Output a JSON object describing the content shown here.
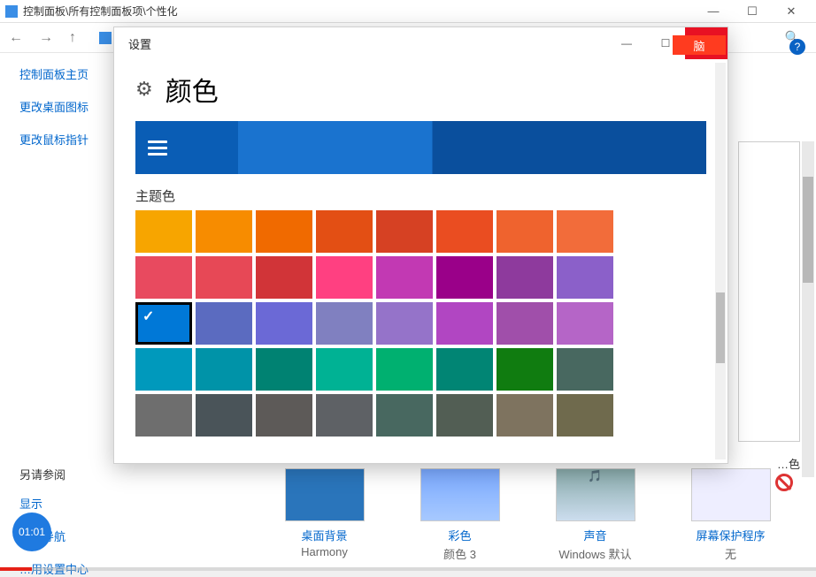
{
  "outer": {
    "title": "控制面板\\所有控制面板项\\个性化",
    "breadcrumb": [
      "控制面板",
      "所有控制面板项",
      "个性化"
    ]
  },
  "leftnav": {
    "home": "控制面板主页",
    "change_icons": "更改桌面图标",
    "change_pointer": "更改鼠标指针",
    "see_also": "另请参阅",
    "display": "显示",
    "nav_taskbar": "…和导航",
    "ease_center": "…用设置中心"
  },
  "tiles": {
    "t1": {
      "title": "桌面背景",
      "sub": "Harmony"
    },
    "t2": {
      "title": "彩色",
      "sub": "颜色 3"
    },
    "t3": {
      "title": "声音",
      "sub": "Windows 默认"
    },
    "t4": {
      "title": "屏幕保护程序",
      "sub": "无"
    }
  },
  "right_hint_label": "…色",
  "help": "?",
  "desk_clip": "脑",
  "settings": {
    "title": "设置",
    "heading": "颜色",
    "section": "主题色",
    "selected_index": 16,
    "colors": [
      "#f7a500",
      "#f78c00",
      "#f06a00",
      "#e34f14",
      "#d64123",
      "#ea4d21",
      "#ef632e",
      "#f26c3a",
      "#e84a5f",
      "#e74856",
      "#d13438",
      "#ff4081",
      "#c239b3",
      "#9a0089",
      "#8e3a9d",
      "#8b60c9",
      "#0078d7",
      "#5b6bc0",
      "#6b69d6",
      "#8080c0",
      "#9573c9",
      "#b146c2",
      "#a04faa",
      "#b565c7",
      "#0099bc",
      "#0093a8",
      "#008272",
      "#00b294",
      "#00b070",
      "#018574",
      "#107c10",
      "#486860",
      "#6e6e6e",
      "#4a5459",
      "#5d5a58",
      "#5e6165",
      "#486860",
      "#525e54",
      "#7e735f",
      "#6f6a4d"
    ]
  },
  "timestamp": "01:01"
}
